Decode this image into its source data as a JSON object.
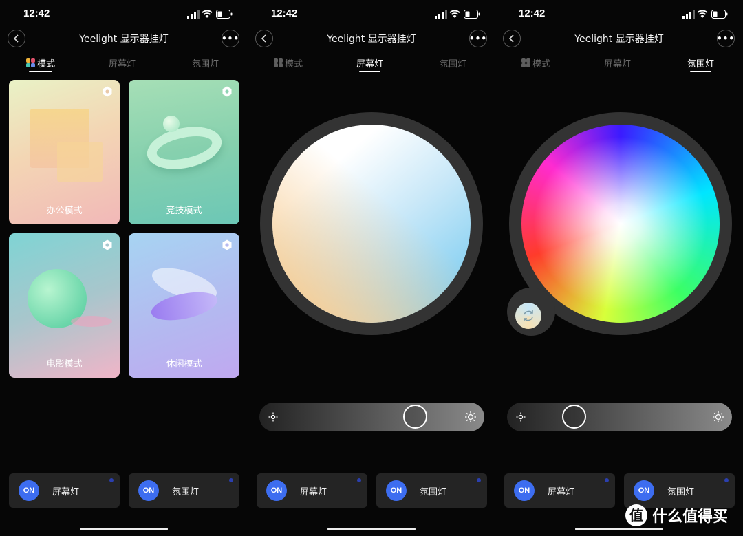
{
  "status_time": "12:42",
  "app_title": "Yeelight 显示器挂灯",
  "tabs": [
    {
      "label": "模式"
    },
    {
      "label": "屏幕灯"
    },
    {
      "label": "氛围灯"
    }
  ],
  "modes": [
    {
      "label": "办公模式",
      "icon": "hexagon-settings-icon"
    },
    {
      "label": "竞技模式",
      "icon": "hexagon-settings-icon"
    },
    {
      "label": "电影模式",
      "icon": "hexagon-settings-icon"
    },
    {
      "label": "休闲模式",
      "icon": "hexagon-settings-icon"
    }
  ],
  "screen_light": {
    "brightness_fraction": 0.72
  },
  "ambient_light": {
    "brightness_fraction": 0.27
  },
  "power_buttons": [
    {
      "on_label": "ON",
      "name": "屏幕灯"
    },
    {
      "on_label": "ON",
      "name": "氛围灯"
    }
  ],
  "watermark": {
    "text": "什么值得买"
  },
  "colors": {
    "accent": "#3d6df0",
    "background": "#060606",
    "card_bg": "#242424"
  }
}
